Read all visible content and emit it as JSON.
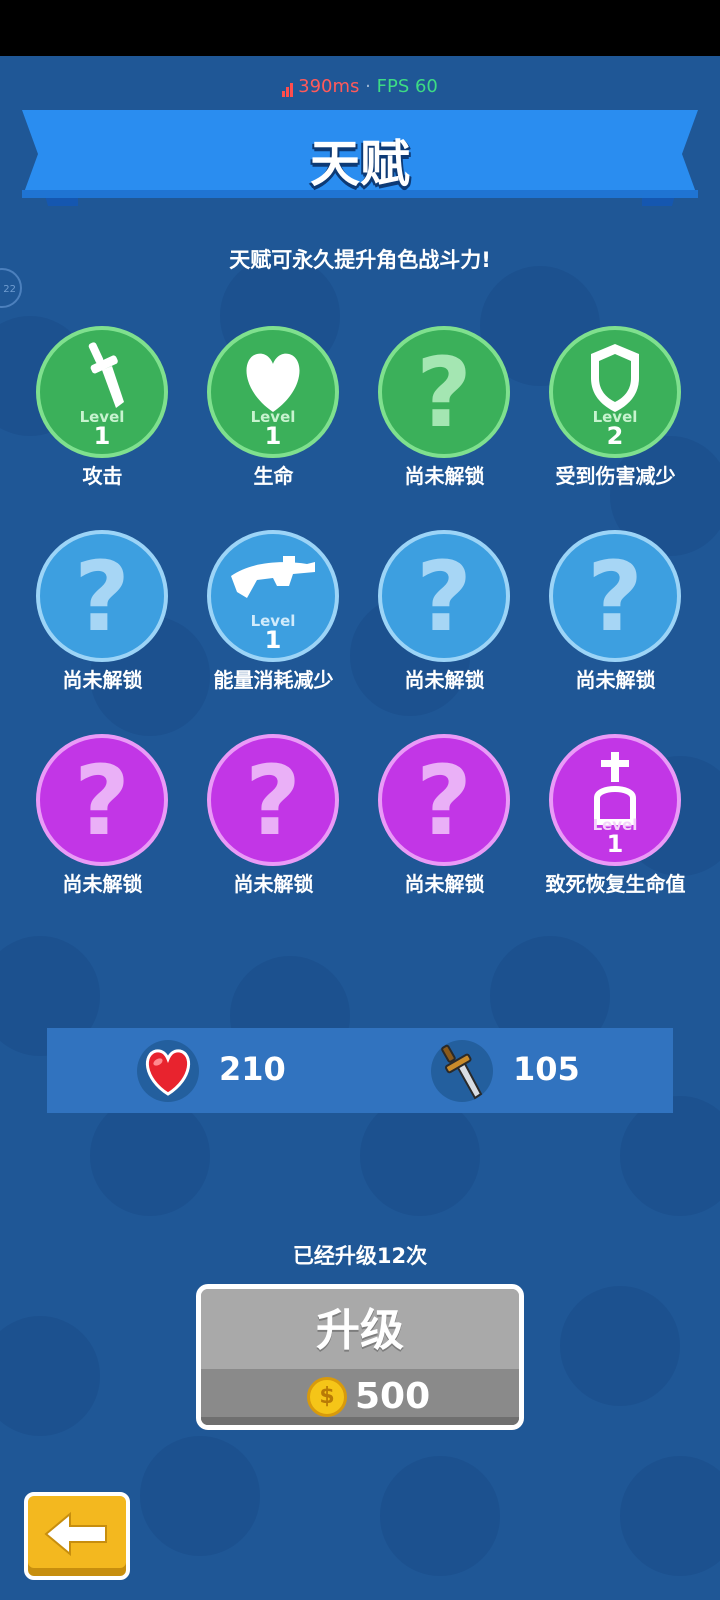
{
  "status": {
    "ping": "390ms",
    "separator": "·",
    "fps": "FPS 60"
  },
  "header": {
    "title": "天赋"
  },
  "subtitle": "天赋可永久提升角色战斗力!",
  "side_badge": "22",
  "talents": [
    {
      "label": "攻击",
      "level_word": "Level",
      "level": "1",
      "color": "green",
      "icon": "sword-icon",
      "unlocked": true
    },
    {
      "label": "生命",
      "level_word": "Level",
      "level": "1",
      "color": "green",
      "icon": "heart-icon",
      "unlocked": true
    },
    {
      "label": "尚未解锁",
      "qmark": "?",
      "color": "green",
      "icon": "question-icon",
      "unlocked": false
    },
    {
      "label": "受到伤害减少",
      "level_word": "Level",
      "level": "2",
      "color": "green",
      "icon": "shield-icon",
      "unlocked": true
    },
    {
      "label": "尚未解锁",
      "qmark": "?",
      "color": "blue",
      "icon": "question-icon",
      "unlocked": false
    },
    {
      "label": "能量消耗减少",
      "level_word": "Level",
      "level": "1",
      "color": "blue",
      "icon": "gun-icon",
      "unlocked": true
    },
    {
      "label": "尚未解锁",
      "qmark": "?",
      "color": "blue",
      "icon": "question-icon",
      "unlocked": false
    },
    {
      "label": "尚未解锁",
      "qmark": "?",
      "color": "blue",
      "icon": "question-icon",
      "unlocked": false
    },
    {
      "label": "尚未解锁",
      "qmark": "?",
      "color": "purple",
      "icon": "question-icon",
      "unlocked": false
    },
    {
      "label": "尚未解锁",
      "qmark": "?",
      "color": "purple",
      "icon": "question-icon",
      "unlocked": false
    },
    {
      "label": "尚未解锁",
      "qmark": "?",
      "color": "purple",
      "icon": "question-icon",
      "unlocked": false
    },
    {
      "label": "致死恢复生命值",
      "level_word": "Level",
      "level": "1",
      "color": "purple",
      "icon": "tombstone-icon",
      "unlocked": true
    }
  ],
  "stats": {
    "health": "210",
    "attack": "105"
  },
  "upgrade": {
    "count_text": "已经升级12次",
    "button_label": "升级",
    "coin_symbol": "$",
    "price": "500"
  },
  "colors": {
    "background": "#1f5796",
    "banner": "#2a8df0",
    "green": "#3bb05a",
    "blue": "#3d9fe0",
    "purple": "#c236e6",
    "back_button": "#f3b81f"
  }
}
